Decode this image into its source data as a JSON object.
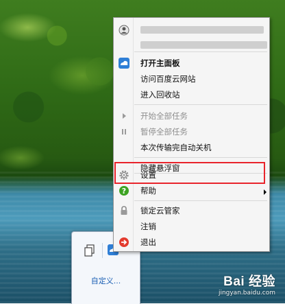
{
  "menu": {
    "header_line1": "",
    "header_line2": "",
    "items": [
      {
        "label": "打开主面板",
        "icon": "cloud-icon",
        "bold": true,
        "disabled": false
      },
      {
        "label": "访问百度云网站",
        "icon": "",
        "disabled": false
      },
      {
        "label": "进入回收站",
        "icon": "",
        "disabled": false
      },
      {
        "label": "开始全部任务",
        "icon": "play-icon",
        "disabled": true
      },
      {
        "label": "暂停全部任务",
        "icon": "pause-icon",
        "disabled": true
      },
      {
        "label": "本次传输完自动关机",
        "icon": "",
        "disabled": false
      },
      {
        "label": "隐藏悬浮窗",
        "icon": "",
        "disabled": false
      },
      {
        "label": "设置",
        "icon": "gear-icon",
        "disabled": false,
        "highlighted": true
      },
      {
        "label": "帮助",
        "icon": "help-icon",
        "disabled": false,
        "submenu": true
      },
      {
        "label": "锁定云管家",
        "icon": "lock-icon",
        "disabled": false
      },
      {
        "label": "注销",
        "icon": "",
        "disabled": false
      },
      {
        "label": "退出",
        "icon": "exit-icon",
        "disabled": false
      }
    ]
  },
  "tray": {
    "customize_label": "自定义..."
  },
  "watermark": {
    "brand": "Bai  经验",
    "url": "jingyan.baidu.com"
  },
  "colors": {
    "highlight_border": "#e8232b",
    "help_green": "#3da323",
    "exit_red": "#e33b2e",
    "cloud_blue": "#2f7fd6"
  }
}
